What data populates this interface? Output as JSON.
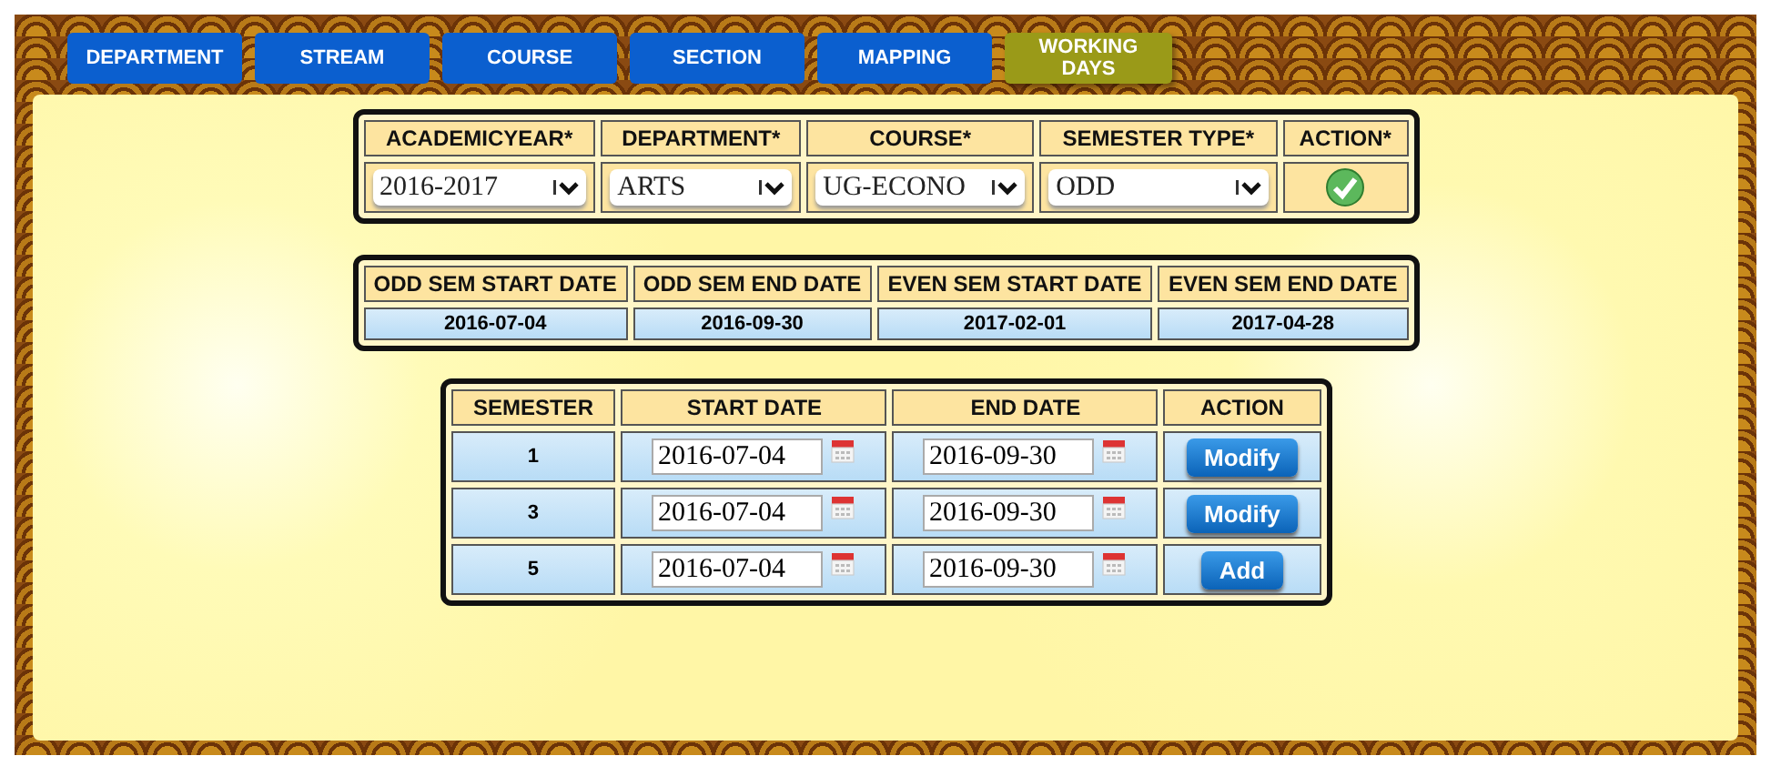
{
  "tabs": [
    {
      "label": "DEPARTMENT",
      "selected": false
    },
    {
      "label": "STREAM",
      "selected": false
    },
    {
      "label": "COURSE",
      "selected": false
    },
    {
      "label": "SECTION",
      "selected": false
    },
    {
      "label": "MAPPING",
      "selected": false
    },
    {
      "label": "WORKING DAYS",
      "selected": true
    }
  ],
  "filter_table": {
    "columns": [
      "ACADEMICYEAR*",
      "DEPARTMENT*",
      "COURSE*",
      "SEMESTER TYPE*",
      "ACTION*"
    ],
    "selects": [
      {
        "value": "2016-2017"
      },
      {
        "value": "ARTS"
      },
      {
        "value": "UG-ECONO"
      },
      {
        "value": "ODD"
      }
    ]
  },
  "dates_table": {
    "columns": [
      "ODD SEM START DATE",
      "ODD SEM END DATE",
      "EVEN SEM START DATE",
      "EVEN SEM END DATE"
    ],
    "values": [
      "2016-07-04",
      "2016-09-30",
      "2017-02-01",
      "2017-04-28"
    ]
  },
  "semester_table": {
    "columns": [
      "SEMESTER",
      "START DATE",
      "END DATE",
      "ACTION"
    ],
    "rows": [
      {
        "semester": "1",
        "start": "2016-07-04",
        "end": "2016-09-30",
        "action": "Modify"
      },
      {
        "semester": "3",
        "start": "2016-07-04",
        "end": "2016-09-30",
        "action": "Modify"
      },
      {
        "semester": "5",
        "start": "2016-07-04",
        "end": "2016-09-30",
        "action": "Add"
      }
    ]
  }
}
